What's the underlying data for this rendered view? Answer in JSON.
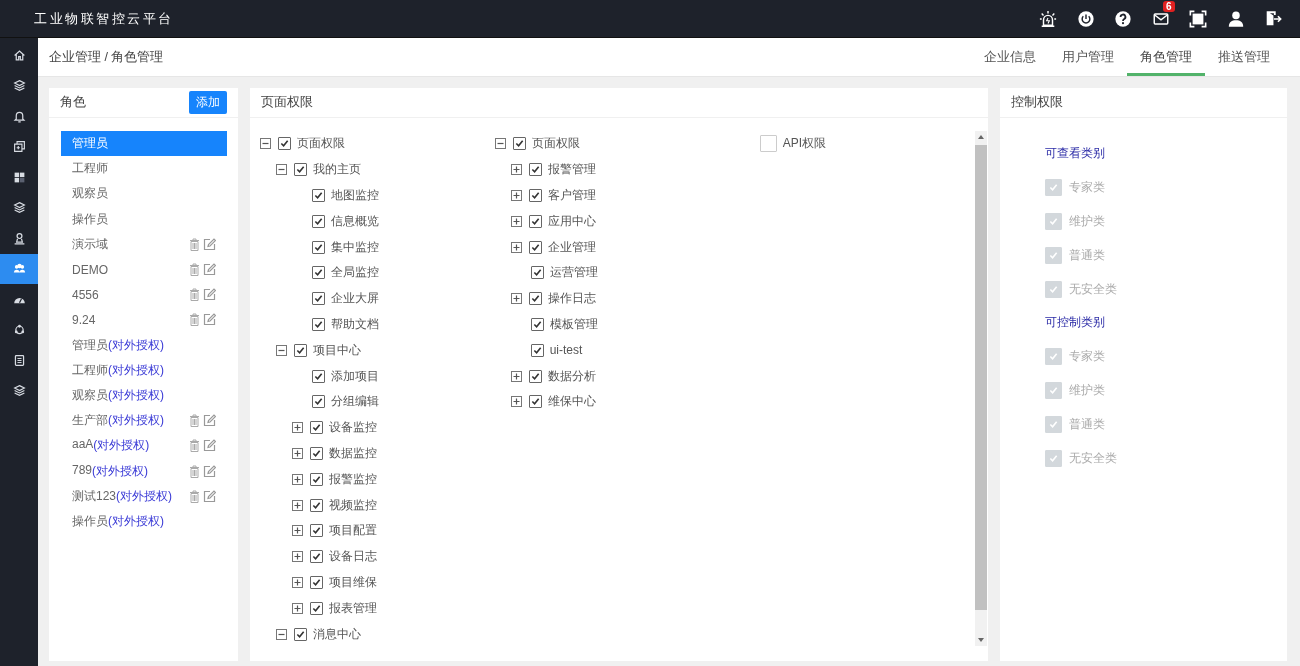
{
  "app": {
    "title": "工业物联智控云平台"
  },
  "toolbar": [
    {
      "kind": "alarm"
    },
    {
      "kind": "power"
    },
    {
      "kind": "help"
    },
    {
      "kind": "mail",
      "badge": "6"
    },
    {
      "kind": "fullscreen"
    },
    {
      "kind": "user"
    },
    {
      "kind": "logout"
    }
  ],
  "sidebar": {
    "items": [
      {
        "kind": "home",
        "selected": false
      },
      {
        "kind": "layers",
        "selected": false
      },
      {
        "kind": "bell",
        "selected": false
      },
      {
        "kind": "copy",
        "selected": false
      },
      {
        "kind": "grid",
        "selected": false
      },
      {
        "kind": "layers",
        "selected": false
      },
      {
        "kind": "user-pin",
        "selected": false
      },
      {
        "kind": "users",
        "selected": true
      },
      {
        "kind": "gauge",
        "selected": false
      },
      {
        "kind": "cycle",
        "selected": false
      },
      {
        "kind": "book",
        "selected": false
      },
      {
        "kind": "layers",
        "selected": false
      }
    ]
  },
  "breadcrumb": "企业管理 / 角色管理",
  "tabs": [
    {
      "label": "企业信息",
      "selected": false
    },
    {
      "label": "用户管理",
      "selected": false
    },
    {
      "label": "角色管理",
      "selected": true
    },
    {
      "label": "推送管理",
      "selected": false
    }
  ],
  "roles": {
    "title": "角色",
    "add_button": "添加",
    "items": [
      {
        "name": "管理员",
        "selected": true,
        "editable": false
      },
      {
        "name": "工程师",
        "selected": false,
        "editable": false
      },
      {
        "name": "观察员",
        "selected": false,
        "editable": false
      },
      {
        "name": "操作员",
        "selected": false,
        "editable": false
      },
      {
        "name": "演示域",
        "selected": false,
        "editable": true
      },
      {
        "name": "DEMO",
        "selected": false,
        "editable": true
      },
      {
        "name": "4556",
        "selected": false,
        "editable": true
      },
      {
        "name": "9.24",
        "selected": false,
        "editable": true
      },
      {
        "name": "管理员",
        "tag": "(对外授权)",
        "selected": false,
        "editable": false
      },
      {
        "name": "工程师",
        "tag": "(对外授权)",
        "selected": false,
        "editable": false
      },
      {
        "name": "观察员",
        "tag": "(对外授权)",
        "selected": false,
        "editable": false
      },
      {
        "name": "生产部",
        "tag": "(对外授权)",
        "selected": false,
        "editable": true
      },
      {
        "name": "aaA",
        "tag": "(对外授权)",
        "selected": false,
        "editable": true
      },
      {
        "name": "789",
        "tag": "(对外授权)",
        "selected": false,
        "editable": true
      },
      {
        "name": "测试123",
        "tag": "(对外授权)",
        "selected": false,
        "editable": true
      },
      {
        "name": "操作员",
        "tag": "(对外授权)",
        "selected": false,
        "editable": false
      }
    ]
  },
  "page_permissions": {
    "title": "页面权限",
    "trees": [
      {
        "nodes": [
          {
            "label": "页面权限",
            "checked": true,
            "expanded": true,
            "children": [
              {
                "label": "我的主页",
                "checked": true,
                "expanded": true,
                "children": [
                  {
                    "label": "地图监控",
                    "checked": true
                  },
                  {
                    "label": "信息概览",
                    "checked": true
                  },
                  {
                    "label": "集中监控",
                    "checked": true
                  },
                  {
                    "label": "全局监控",
                    "checked": true
                  },
                  {
                    "label": "企业大屏",
                    "checked": true
                  },
                  {
                    "label": "帮助文档",
                    "checked": true
                  }
                ]
              },
              {
                "label": "项目中心",
                "checked": true,
                "expanded": true,
                "children": [
                  {
                    "label": "添加项目",
                    "checked": true
                  },
                  {
                    "label": "分组编辑",
                    "checked": true
                  },
                  {
                    "label": "设备监控",
                    "checked": true,
                    "expanded": false
                  },
                  {
                    "label": "数据监控",
                    "checked": true,
                    "expanded": false
                  },
                  {
                    "label": "报警监控",
                    "checked": true,
                    "expanded": false
                  },
                  {
                    "label": "视频监控",
                    "checked": true,
                    "expanded": false
                  },
                  {
                    "label": "项目配置",
                    "checked": true,
                    "expanded": false
                  },
                  {
                    "label": "设备日志",
                    "checked": true,
                    "expanded": false
                  },
                  {
                    "label": "项目维保",
                    "checked": true,
                    "expanded": false
                  },
                  {
                    "label": "报表管理",
                    "checked": true,
                    "expanded": false
                  }
                ]
              },
              {
                "label": "消息中心",
                "checked": true,
                "expanded": true
              }
            ]
          }
        ]
      },
      {
        "nodes": [
          {
            "label": "页面权限",
            "checked": true,
            "expanded": true,
            "children": [
              {
                "label": "报警管理",
                "checked": true,
                "expanded": false
              },
              {
                "label": "客户管理",
                "checked": true,
                "expanded": false
              },
              {
                "label": "应用中心",
                "checked": true,
                "expanded": false
              },
              {
                "label": "企业管理",
                "checked": true,
                "expanded": false
              },
              {
                "label": "运营管理",
                "checked": true
              },
              {
                "label": "操作日志",
                "checked": true,
                "expanded": false
              },
              {
                "label": "模板管理",
                "checked": true
              },
              {
                "label": "ui-test",
                "checked": true
              },
              {
                "label": "数据分析",
                "checked": true,
                "expanded": false
              },
              {
                "label": "维保中心",
                "checked": true,
                "expanded": false
              }
            ]
          }
        ]
      },
      {
        "nodes": [
          {
            "label": "API权限",
            "checked": false
          }
        ]
      }
    ]
  },
  "control_permissions": {
    "title": "控制权限",
    "groups": [
      {
        "heading": "可查看类别",
        "items": [
          {
            "label": "专家类",
            "checked": true,
            "disabled": true
          },
          {
            "label": "维护类",
            "checked": true,
            "disabled": true
          },
          {
            "label": "普通类",
            "checked": true,
            "disabled": true
          },
          {
            "label": "无安全类",
            "checked": true,
            "disabled": true
          }
        ]
      },
      {
        "heading": "可控制类别",
        "items": [
          {
            "label": "专家类",
            "checked": true,
            "disabled": true
          },
          {
            "label": "维护类",
            "checked": true,
            "disabled": true
          },
          {
            "label": "普通类",
            "checked": true,
            "disabled": true
          },
          {
            "label": "无安全类",
            "checked": true,
            "disabled": true
          }
        ]
      }
    ]
  }
}
